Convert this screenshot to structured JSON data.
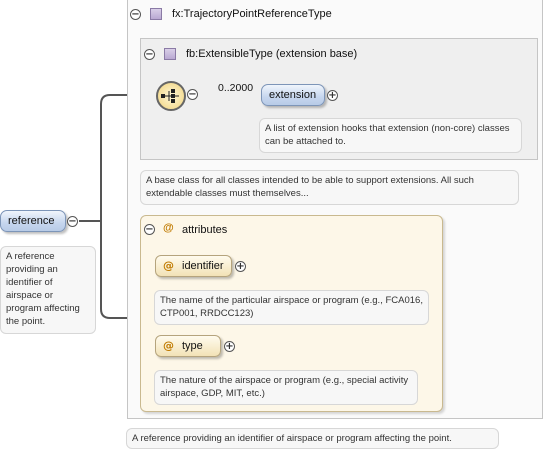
{
  "root": {
    "element_name": "reference",
    "documentation": "A reference providing an identifier of airspace or program affecting the point.",
    "type_name": "fx:TrajectoryPointReferenceType",
    "type_documentation": "A reference providing an identifier of airspace or program affecting the point."
  },
  "extension_base": {
    "label": "fb:ExtensibleType (extension base)",
    "documentation": "A base class for all classes intended to be able to support extensions. All such extendable classes must themselves...",
    "sequence_cardinality": "0..2000",
    "element": {
      "name": "extension",
      "documentation": "A list of extension hooks that extension (non-core) classes can be attached to."
    }
  },
  "attributes": {
    "label": "attributes",
    "items": [
      {
        "name": "identifier",
        "documentation": "The name of the particular airspace or program (e.g., FCA016, CTP001, RRDCC123)"
      },
      {
        "name": "type",
        "documentation": "The nature of the airspace or program (e.g., special activity airspace, GDP, MIT, etc.)"
      }
    ]
  },
  "icons": {
    "collapse": "minus-circle-icon",
    "expand": "plus-circle-icon",
    "complex_type": "complex-type-icon",
    "sequence": "sequence-compositor-icon",
    "attribute": "attribute-at-icon"
  },
  "colors": {
    "element_fill": "#c6d6ee",
    "attribute_fill": "#f2e2b6",
    "attributes_group_fill": "#fdf7e8",
    "type_frame_fill": "#f7f7f7",
    "connector": "#555555"
  }
}
